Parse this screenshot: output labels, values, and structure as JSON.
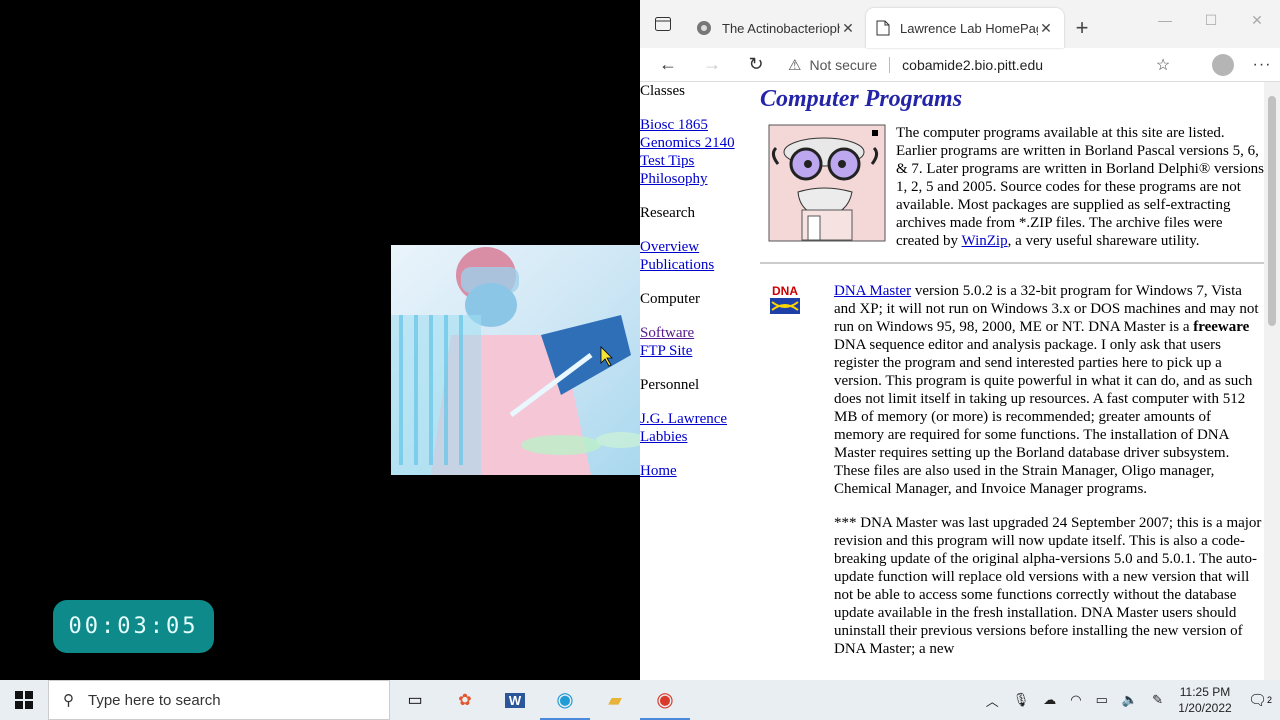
{
  "overlay": {
    "timer": "00:03:05"
  },
  "browser": {
    "tabs": [
      {
        "title": "The Actinobacteriophage",
        "active": false
      },
      {
        "title": "Lawrence Lab HomePage",
        "active": true
      }
    ],
    "address": {
      "warning": "Not secure",
      "url": "cobamide2.bio.pitt.edu"
    }
  },
  "sidebar": {
    "classes_heading": "Classes",
    "classes": [
      "Biosc 1865",
      "Genomics 2140",
      "Test Tips",
      "Philosophy"
    ],
    "research_heading": "Research",
    "research": [
      "Overview",
      "Publications"
    ],
    "computer_heading": "Computer",
    "computer": [
      "Software",
      "FTP Site"
    ],
    "personnel_heading": "Personnel",
    "personnel": [
      "J.G. Lawrence",
      "Labbies"
    ],
    "home": "Home"
  },
  "main": {
    "title": "Computer Programs",
    "intro_text": "The computer programs available at this site are listed. Earlier programs are written in Borland Pascal versions 5, 6, & 7. Later programs are written in Borland Delphi® versions 1, 2, 5 and 2005. Source codes for these programs are not available. Most packages are supplied as self-extracting archives made from *.ZIP files. The archive files were created by ",
    "winzip_link": "WinZip",
    "intro_tail": ", a very useful shareware utility.",
    "dna_icon_label": "DNA",
    "dna_link": "DNA Master",
    "dna_text_1": " version 5.0.2 is a 32-bit program for Windows 7, Vista and XP; it will not run on Windows 3.x or DOS machines and may not run on Windows 95, 98, 2000, ME or NT. DNA Master is a ",
    "dna_bold": "freeware",
    "dna_text_2": " DNA sequence editor and analysis package. I only ask that users register the program and send interested parties here to pick up a version. This program is quite powerful in what it can do, and as such does not limit itself in taking up resources. A fast computer with 512 MB of memory (or more) is recommended; greater amounts of memory are required for some functions. The installation of DNA Master requires setting up the Borland database driver subsystem. These files are also used in the Strain Manager, Oligo manager, Chemical Manager, and Invoice Manager programs.",
    "dna_update": "*** DNA Master was last upgraded 24 September 2007; this is a major revision and this program will now update itself. This is also a code-breaking update of the original alpha-versions 5.0 and 5.0.1. The auto-update function will replace old versions with a new version that will not be able to access some functions correctly without the database update available in the fresh installation. DNA Master users should uninstall their previous versions before installing the new version of DNA Master; a new"
  },
  "taskbar": {
    "search_placeholder": "Type here to search",
    "time": "11:25 PM",
    "date": "1/20/2022",
    "notification_count": "2"
  }
}
